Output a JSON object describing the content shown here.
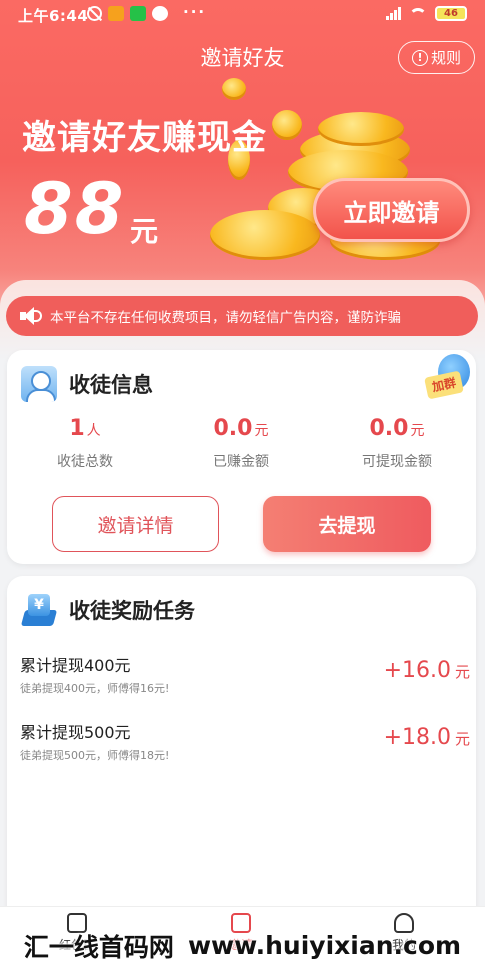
{
  "status_bar": {
    "time": "上午6:44",
    "dots": "···",
    "battery": "46"
  },
  "nav": {
    "title": "邀请好友",
    "rules": "规则"
  },
  "hero": {
    "title": "邀请好友赚现金",
    "amount": "88",
    "unit": "元",
    "invite_button": "立即邀请"
  },
  "notice": {
    "text": "本平台不存在任何收费项目，请勿轻信广告内容，谨防诈骗"
  },
  "disciple_info": {
    "title": "收徒信息",
    "badge": "加群",
    "stats": [
      {
        "value": "1",
        "unit": "人",
        "label": "收徒总数"
      },
      {
        "value": "0.0",
        "unit": "元",
        "label": "已赚金额"
      },
      {
        "value": "0.0",
        "unit": "元",
        "label": "可提现金额"
      }
    ],
    "detail_button": "邀请详情",
    "withdraw_button": "去提现"
  },
  "reward_tasks": {
    "title": "收徒奖励任务",
    "money_symbol": "¥",
    "items": [
      {
        "name": "累计提现400元",
        "desc": "徒弟提现400元，师傅得16元!",
        "reward": "+16.0",
        "unit": "元"
      },
      {
        "name": "累计提现500元",
        "desc": "徒弟提现500元，师傅得18元!",
        "reward": "+18.0",
        "unit": "元"
      }
    ]
  },
  "tabbar": {
    "items": [
      {
        "label": "红包群",
        "icon": "red-packet-icon"
      },
      {
        "label": "邀请",
        "icon": "invite-icon"
      },
      {
        "label": "我的",
        "icon": "user-icon"
      }
    ]
  },
  "watermark": {
    "left": "汇一线首码网",
    "right": "www.huiyixian.com"
  },
  "colors": {
    "primary": "#f05e5b",
    "accent_text": "#e5484d",
    "coin": "#f9b81f"
  }
}
